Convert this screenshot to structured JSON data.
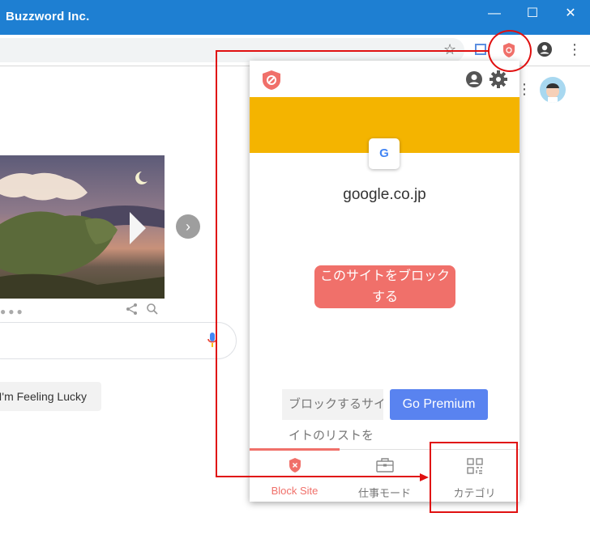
{
  "window": {
    "title": "Buzzword Inc.",
    "minimize_glyph": "—",
    "maximize_glyph": "☐",
    "close_glyph": "✕"
  },
  "toolbar": {
    "star_icon": "star-icon",
    "extension_icon": "block-site-icon",
    "profile_icon": "profile-icon",
    "menu_icon": "kebab-menu-icon"
  },
  "google": {
    "lucky_label": "I'm Feeling Lucky",
    "next_glyph": "›",
    "dots": "●●●"
  },
  "popup": {
    "favicon_letter": "G",
    "domain": "google.co.jp",
    "block_button": "このサイトをブロックする",
    "list_button": "ブロックするサイトのリストを",
    "list_overflow": "イトのリストを",
    "premium_button": "Go Premium",
    "tabs": [
      {
        "label": "Block Site",
        "icon": "shield-icon",
        "active": true
      },
      {
        "label": "仕事モード",
        "icon": "briefcase-icon",
        "active": false
      },
      {
        "label": "カテゴリ",
        "icon": "grid-icon",
        "active": false
      }
    ]
  },
  "colors": {
    "titlebar": "#1e7fd2",
    "accent_red": "#f0706a",
    "yellow": "#f4b400",
    "premium_blue": "#5983f0",
    "annotation_red": "#e01010"
  }
}
